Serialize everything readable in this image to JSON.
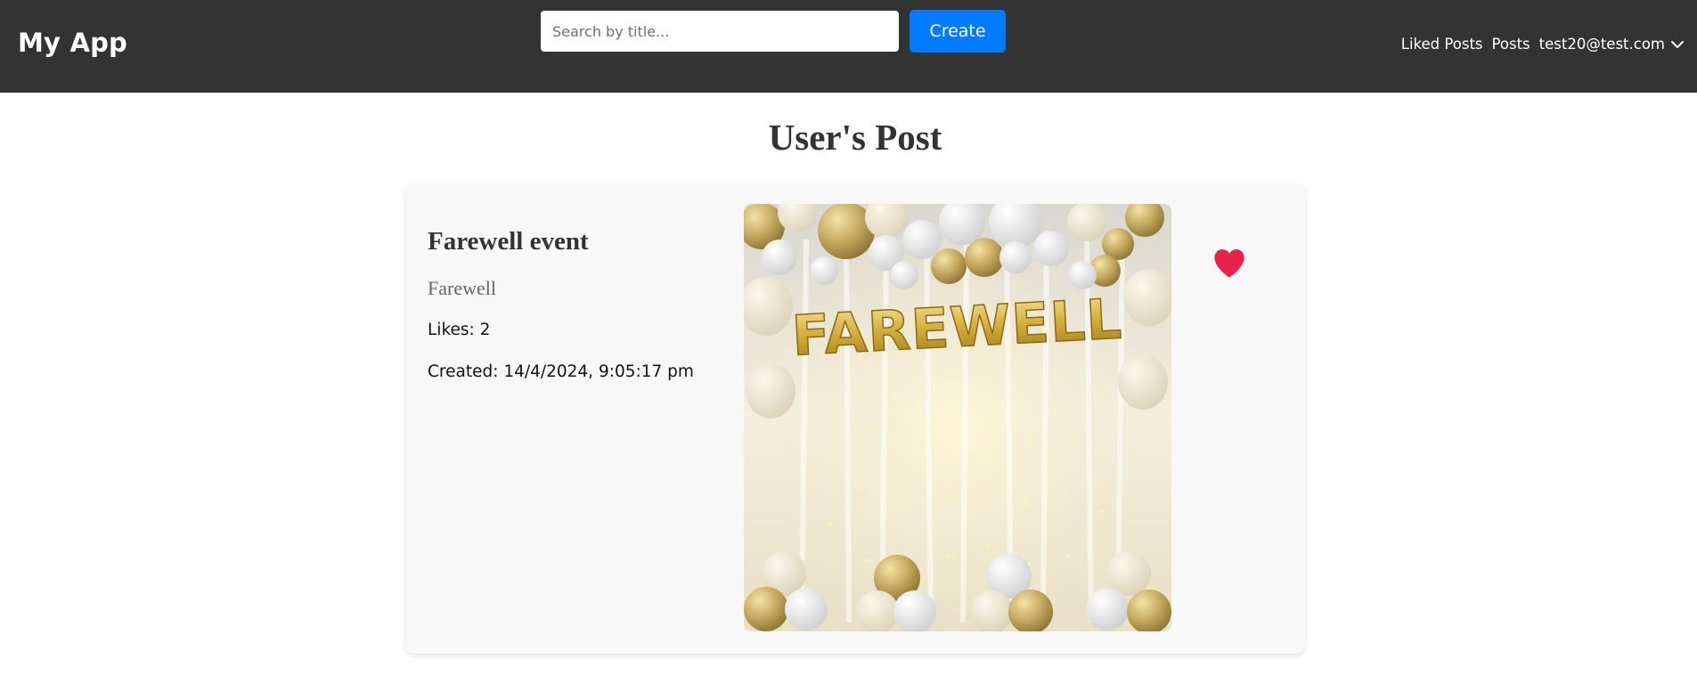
{
  "navbar": {
    "brand": "My App",
    "search_placeholder": "Search by title...",
    "create_label": "Create",
    "links": {
      "liked_posts": "Liked Posts",
      "posts": "Posts",
      "user_email": "test20@test.com"
    }
  },
  "page": {
    "title": "User's Post"
  },
  "post": {
    "title": "Farewell event",
    "description": "Farewell",
    "likes": "Likes: 2",
    "created": "Created: 14/4/2024, 9:05:17 pm",
    "image_text": "FAREWELL",
    "liked": true
  },
  "colors": {
    "navbar_bg": "#333333",
    "accent": "#007bff",
    "heart": "#e8224b",
    "card_bg": "#f8f8f8"
  },
  "icons": {
    "user_menu": "chevron-down-icon",
    "like": "heart-icon"
  }
}
